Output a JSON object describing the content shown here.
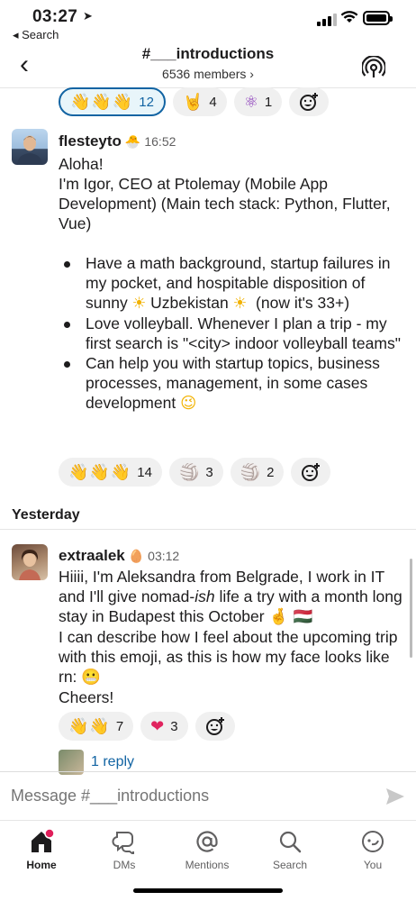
{
  "status_bar": {
    "time": "03:27",
    "back_app": "◂ Search"
  },
  "header": {
    "channel_name": "#___introductions",
    "members": "6536 members ›"
  },
  "top_reactions": [
    {
      "emoji": "👋👋👋",
      "count": "12",
      "active": true
    },
    {
      "emoji": "🤘",
      "count": "4"
    },
    {
      "emoji": "⚛",
      "count": "1"
    }
  ],
  "message1": {
    "author": "flesteyto",
    "status_emoji": "🐣",
    "time": "16:52",
    "greeting": "Aloha!",
    "intro": "I'm Igor, CEO at Ptolemay (Mobile App Development) (Main tech stack: Python, Flutter, Vue)",
    "bullet1_a": "Have a math background, startup failures in my pocket, and hospitable disposition of sunny",
    "bullet1_sun": "☀",
    "bullet1_b": "Uzbekistan",
    "bullet1_c": "(now it's 33+)",
    "bullet2": "Love volleyball. Whenever I plan a trip - my first search is \"<city> indoor volleyball teams\"",
    "bullet3": "Can help you with startup topics, business processes, management, in some cases development",
    "bullet3_emoji": "😉",
    "reactions": [
      {
        "emoji": "👋👋👋",
        "count": "14"
      },
      {
        "emoji": "🏐",
        "count": "3"
      },
      {
        "emoji": "🏐",
        "count": "2"
      }
    ]
  },
  "day_divider": "Yesterday",
  "message2": {
    "author": "extraalek",
    "status_emoji": "🥚",
    "time": "03:12",
    "line1_a": "Hiiii, I'm Aleksandra from Belgrade, I work in IT and I'll give nomad-",
    "line1_ish": "ish",
    "line1_b": " life a try with a month long stay in Budapest this October",
    "line1_emoji": "🤞 🇭🇺",
    "line2": "I can describe how I feel about the upcoming trip with this emoji, as this is how my face looks like rn:",
    "line2_emoji": "😬",
    "line3": "Cheers!",
    "reactions": [
      {
        "emoji": "👋👋",
        "count": "7"
      },
      {
        "emoji": "❤",
        "count": "3"
      }
    ],
    "reply_text": "1 reply"
  },
  "composer": {
    "placeholder": "Message #___introductions"
  },
  "tabs": [
    {
      "label": "Home",
      "icon": "home-icon"
    },
    {
      "label": "DMs",
      "icon": "dms-icon"
    },
    {
      "label": "Mentions",
      "icon": "mentions-icon"
    },
    {
      "label": "Search",
      "icon": "search-icon"
    },
    {
      "label": "You",
      "icon": "you-icon"
    }
  ],
  "colors": {
    "accent": "#1264a3",
    "notification": "#e01e5a",
    "reaction_active_bg": "#e8f5fa"
  }
}
